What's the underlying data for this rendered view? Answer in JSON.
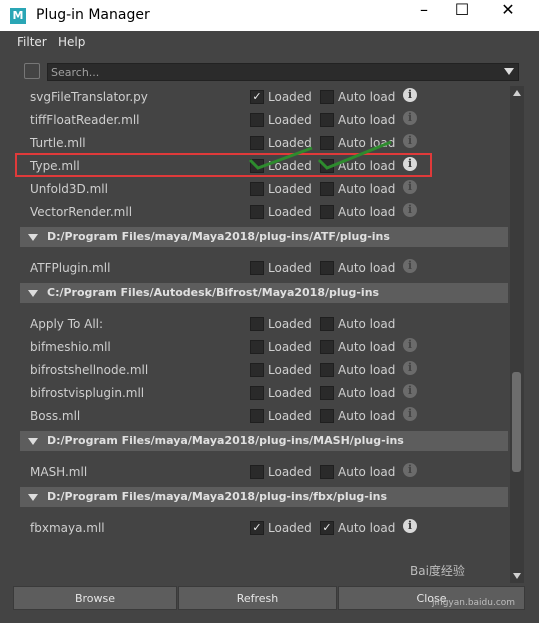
{
  "window": {
    "title": "Plug-in Manager",
    "icon_letter": "M",
    "controls": {
      "minimize": "–",
      "maximize": "☐",
      "close": "✕"
    }
  },
  "menu": {
    "items": [
      "Filter",
      "Help"
    ]
  },
  "search": {
    "placeholder": "Search..."
  },
  "labels": {
    "loaded": "Loaded",
    "auto_load": "Auto load",
    "info_glyph": "i"
  },
  "rows_top": [
    {
      "name": "svgFileTranslator.py",
      "loaded": true,
      "auto": false,
      "info_dim": false
    },
    {
      "name": "tiffFloatReader.mll",
      "loaded": false,
      "auto": false,
      "info_dim": true
    },
    {
      "name": "Turtle.mll",
      "loaded": false,
      "auto": false,
      "info_dim": true
    },
    {
      "name": "Type.mll",
      "loaded": false,
      "auto": false,
      "info_dim": false
    },
    {
      "name": "Unfold3D.mll",
      "loaded": false,
      "auto": false,
      "info_dim": true
    },
    {
      "name": "VectorRender.mll",
      "loaded": false,
      "auto": false,
      "info_dim": true
    }
  ],
  "sections": [
    {
      "title": "D:/Program Files/maya/Maya2018/plug-ins/ATF/plug-ins",
      "rows": [
        {
          "name": "ATFPlugin.mll",
          "loaded": false,
          "auto": false,
          "info_dim": true
        }
      ]
    },
    {
      "title": "C:/Program Files/Autodesk/Bifrost/Maya2018/plug-ins",
      "rows": [
        {
          "name": "Apply To All:",
          "loaded": false,
          "auto": false,
          "info_dim": null
        },
        {
          "name": "bifmeshio.mll",
          "loaded": false,
          "auto": false,
          "info_dim": true
        },
        {
          "name": "bifrostshellnode.mll",
          "loaded": false,
          "auto": false,
          "info_dim": true
        },
        {
          "name": "bifrostvisplugin.mll",
          "loaded": false,
          "auto": false,
          "info_dim": true
        },
        {
          "name": "Boss.mll",
          "loaded": false,
          "auto": false,
          "info_dim": true
        }
      ]
    },
    {
      "title": "D:/Program Files/maya/Maya2018/plug-ins/MASH/plug-ins",
      "rows": [
        {
          "name": "MASH.mll",
          "loaded": false,
          "auto": false,
          "info_dim": true
        }
      ]
    },
    {
      "title": "D:/Program Files/maya/Maya2018/plug-ins/fbx/plug-ins",
      "rows": [
        {
          "name": "fbxmaya.mll",
          "loaded": true,
          "auto": true,
          "info_dim": false
        }
      ]
    }
  ],
  "buttons": {
    "browse": "Browse",
    "refresh": "Refresh",
    "close": "Close"
  },
  "watermark": {
    "main": "Bai度经验",
    "sub": "jingyan.baidu.com"
  },
  "colors": {
    "highlight": "#e03a3a",
    "annotation_check": "#2e8b2e",
    "background": "#444444"
  },
  "check_glyph": "✓"
}
